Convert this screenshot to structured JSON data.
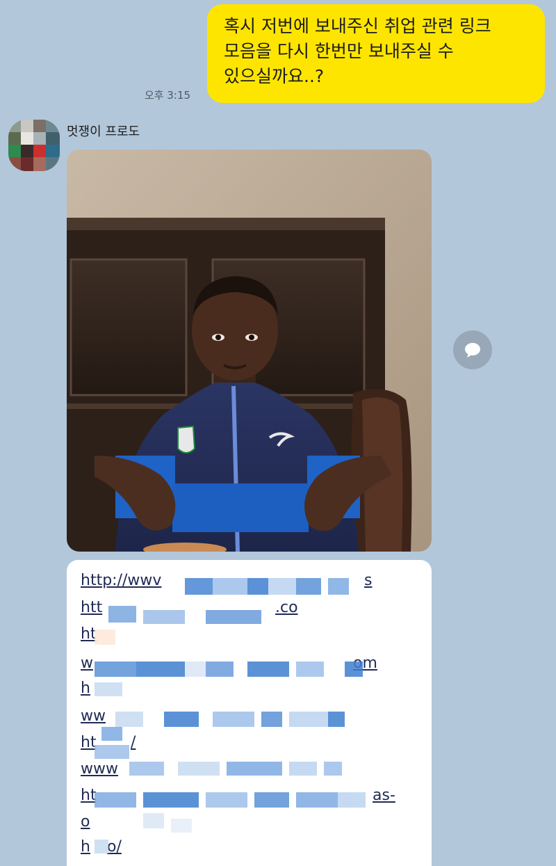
{
  "outgoing_message": {
    "lines": [
      "혹시 저번에 보내주신 취업 관련 링크",
      "모음을 다시 한번만 보내주실 수",
      "있으실까요..?"
    ],
    "time": "오후 3:15",
    "bubble_color": "#fee500"
  },
  "incoming": {
    "sender_name": "멋쟁이 프로도",
    "photo_icon": "photo-image",
    "share_icon": "speech-bubble-icon"
  },
  "links": {
    "visible_fragments": [
      {
        "start": "http://wwv",
        "end": "s"
      },
      {
        "start": "htt",
        "end": ".co"
      },
      {
        "start": "ht",
        "end": ""
      },
      {
        "start": "w",
        "end": "om"
      },
      {
        "start": "h",
        "end": ""
      },
      {
        "start": "ww",
        "end": ""
      },
      {
        "start": "ht",
        "end": "/"
      },
      {
        "start": "www",
        "end": ""
      },
      {
        "start": "ht",
        "end": "as-"
      },
      {
        "start": "o",
        "end": ""
      },
      {
        "start": "h",
        "end": "o/"
      }
    ]
  },
  "colors": {
    "background": "#b2c7da",
    "link_color": "#1f2a55",
    "mosaic": "#3f7fd0"
  }
}
